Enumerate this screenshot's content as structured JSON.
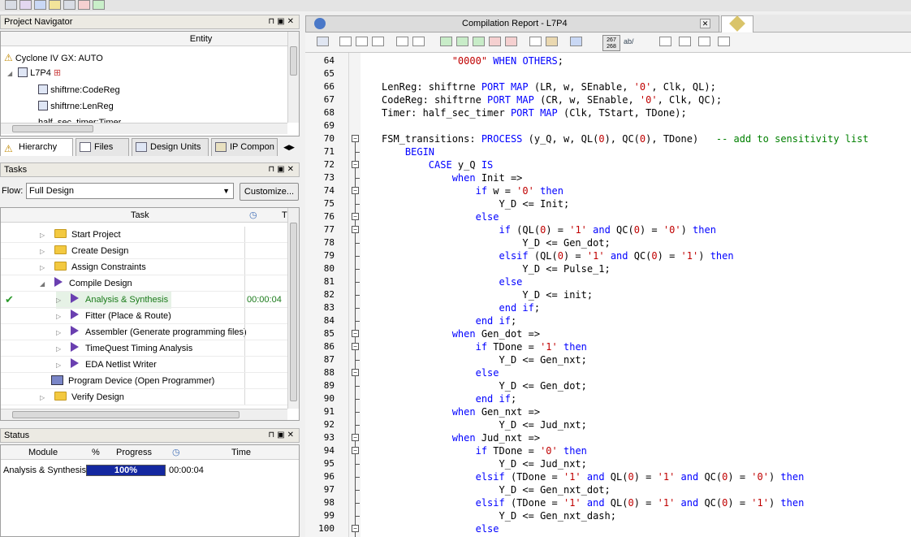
{
  "toolbar": {
    "icons": [
      "stop-icon",
      "start-analysis-icon",
      "timequest-icon",
      "netlist-icon",
      "chip-planner-icon",
      "rtl-icon",
      "check-icon"
    ]
  },
  "project_navigator": {
    "title": "Project Navigator",
    "column": "Entity",
    "items": [
      {
        "label": "Cyclone IV GX: AUTO"
      },
      {
        "label": "L7P4"
      },
      {
        "label": "shiftrne:CodeReg"
      },
      {
        "label": "shiftrne:LenReg"
      },
      {
        "label": "half_sec_timer:Timer"
      }
    ],
    "tabs": [
      "Hierarchy",
      "Files",
      "Design Units",
      "IP Compon"
    ]
  },
  "tasks": {
    "title": "Tasks",
    "flow_label": "Flow:",
    "flow_value": "Full Design",
    "customize_label": "Customize...",
    "col_task": "Task",
    "col_time": "T",
    "rows": [
      {
        "label": "Start Project",
        "time": ""
      },
      {
        "label": "Create Design",
        "time": ""
      },
      {
        "label": "Assign Constraints",
        "time": ""
      },
      {
        "label": "Compile Design",
        "time": ""
      },
      {
        "label": "Analysis & Synthesis",
        "time": "00:00:04"
      },
      {
        "label": "Fitter (Place & Route)",
        "time": ""
      },
      {
        "label": "Assembler (Generate programming files)",
        "time": ""
      },
      {
        "label": "TimeQuest Timing Analysis",
        "time": ""
      },
      {
        "label": "EDA Netlist Writer",
        "time": ""
      },
      {
        "label": "Program Device (Open Programmer)",
        "time": ""
      },
      {
        "label": "Verify Design",
        "time": ""
      }
    ]
  },
  "status": {
    "title": "Status",
    "col_module": "Module",
    "col_pct": "%",
    "col_progress": "Progress",
    "col_time": "Time",
    "row": {
      "module": "Analysis & Synthesis",
      "progress_label": "100%",
      "progress": 1.0,
      "time": "00:00:04"
    }
  },
  "editor": {
    "tab_title": "Compilation Report - L7P4",
    "toolbar_text": "267\n268",
    "lines": [
      {
        "n": "64",
        "t": [
          [
            "            ",
            ""
          ],
          [
            "\"0000\"",
            "st"
          ],
          [
            " ",
            ""
          ],
          [
            "WHEN",
            "kw"
          ],
          [
            " ",
            ""
          ],
          [
            "OTHERS",
            "kw"
          ],
          [
            ";",
            ""
          ]
        ]
      },
      {
        "n": "65",
        "t": []
      },
      {
        "n": "66",
        "t": [
          [
            "LenReg: shiftrne ",
            ""
          ],
          [
            "PORT MAP",
            "kw"
          ],
          [
            " (LR, w, SEnable, ",
            ""
          ],
          [
            "'0'",
            "st"
          ],
          [
            ", Clk, QL);",
            ""
          ]
        ]
      },
      {
        "n": "67",
        "t": [
          [
            "CodeReg: shiftrne ",
            ""
          ],
          [
            "PORT MAP",
            "kw"
          ],
          [
            " (CR, w, SEnable, ",
            ""
          ],
          [
            "'0'",
            "st"
          ],
          [
            ", Clk, QC);",
            ""
          ]
        ]
      },
      {
        "n": "68",
        "t": [
          [
            "Timer: half_sec_timer ",
            ""
          ],
          [
            "PORT MAP",
            "kw"
          ],
          [
            " (Clk, TStart, TDone);",
            ""
          ]
        ]
      },
      {
        "n": "69",
        "t": []
      },
      {
        "n": "70",
        "t": [
          [
            "FSM_transitions: ",
            ""
          ],
          [
            "PROCESS",
            "kw"
          ],
          [
            " (y_Q, w, QL(",
            ""
          ],
          [
            "0",
            "st"
          ],
          [
            "), QC(",
            ""
          ],
          [
            "0",
            "st"
          ],
          [
            "), TDone)   ",
            ""
          ],
          [
            "-- add to sensitivity list",
            "cm"
          ]
        ]
      },
      {
        "n": "71",
        "t": [
          [
            "    ",
            ""
          ],
          [
            "BEGIN",
            "kw"
          ]
        ]
      },
      {
        "n": "72",
        "t": [
          [
            "        ",
            ""
          ],
          [
            "CASE",
            "kw"
          ],
          [
            " y_Q ",
            ""
          ],
          [
            "IS",
            "kw"
          ]
        ]
      },
      {
        "n": "73",
        "t": [
          [
            "            ",
            ""
          ],
          [
            "when",
            "kw"
          ],
          [
            " Init =>",
            ""
          ]
        ]
      },
      {
        "n": "74",
        "t": [
          [
            "                ",
            ""
          ],
          [
            "if",
            "kw"
          ],
          [
            " w = ",
            ""
          ],
          [
            "'0'",
            "st"
          ],
          [
            " ",
            ""
          ],
          [
            "then",
            "kw"
          ]
        ]
      },
      {
        "n": "75",
        "t": [
          [
            "                    Y_D <= Init;",
            ""
          ]
        ]
      },
      {
        "n": "76",
        "t": [
          [
            "                ",
            ""
          ],
          [
            "else",
            "kw"
          ]
        ]
      },
      {
        "n": "77",
        "t": [
          [
            "                    ",
            ""
          ],
          [
            "if",
            "kw"
          ],
          [
            " (QL(",
            ""
          ],
          [
            "0",
            "st"
          ],
          [
            ") = ",
            ""
          ],
          [
            "'1'",
            "st"
          ],
          [
            " ",
            ""
          ],
          [
            "and",
            "kw"
          ],
          [
            " QC(",
            ""
          ],
          [
            "0",
            "st"
          ],
          [
            ") = ",
            ""
          ],
          [
            "'0'",
            "st"
          ],
          [
            ") ",
            ""
          ],
          [
            "then",
            "kw"
          ]
        ]
      },
      {
        "n": "78",
        "t": [
          [
            "                        Y_D <= Gen_dot;",
            ""
          ]
        ]
      },
      {
        "n": "79",
        "t": [
          [
            "                    ",
            ""
          ],
          [
            "elsif",
            "kw"
          ],
          [
            " (QL(",
            ""
          ],
          [
            "0",
            "st"
          ],
          [
            ") = ",
            ""
          ],
          [
            "'1'",
            "st"
          ],
          [
            " ",
            ""
          ],
          [
            "and",
            "kw"
          ],
          [
            " QC(",
            ""
          ],
          [
            "0",
            "st"
          ],
          [
            ") = ",
            ""
          ],
          [
            "'1'",
            "st"
          ],
          [
            ") ",
            ""
          ],
          [
            "then",
            "kw"
          ]
        ]
      },
      {
        "n": "80",
        "t": [
          [
            "                        Y_D <= Pulse_1;",
            ""
          ]
        ]
      },
      {
        "n": "81",
        "t": [
          [
            "                    ",
            ""
          ],
          [
            "else",
            "kw"
          ]
        ]
      },
      {
        "n": "82",
        "t": [
          [
            "                        Y_D <= init;",
            ""
          ]
        ]
      },
      {
        "n": "83",
        "t": [
          [
            "                    ",
            ""
          ],
          [
            "end if",
            "kw"
          ],
          [
            ";",
            ""
          ]
        ]
      },
      {
        "n": "84",
        "t": [
          [
            "                ",
            ""
          ],
          [
            "end if",
            "kw"
          ],
          [
            ";",
            ""
          ]
        ]
      },
      {
        "n": "85",
        "t": [
          [
            "            ",
            ""
          ],
          [
            "when",
            "kw"
          ],
          [
            " Gen_dot =>",
            ""
          ]
        ]
      },
      {
        "n": "86",
        "t": [
          [
            "                ",
            ""
          ],
          [
            "if",
            "kw"
          ],
          [
            " TDone = ",
            ""
          ],
          [
            "'1'",
            "st"
          ],
          [
            " ",
            ""
          ],
          [
            "then",
            "kw"
          ]
        ]
      },
      {
        "n": "87",
        "t": [
          [
            "                    Y_D <= Gen_nxt;",
            ""
          ]
        ]
      },
      {
        "n": "88",
        "t": [
          [
            "                ",
            ""
          ],
          [
            "else",
            "kw"
          ]
        ]
      },
      {
        "n": "89",
        "t": [
          [
            "                    Y_D <= Gen_dot;",
            ""
          ]
        ]
      },
      {
        "n": "90",
        "t": [
          [
            "                ",
            ""
          ],
          [
            "end if",
            "kw"
          ],
          [
            ";",
            ""
          ]
        ]
      },
      {
        "n": "91",
        "t": [
          [
            "            ",
            ""
          ],
          [
            "when",
            "kw"
          ],
          [
            " Gen_nxt =>",
            ""
          ]
        ]
      },
      {
        "n": "92",
        "t": [
          [
            "                    Y_D <= Jud_nxt;",
            ""
          ]
        ]
      },
      {
        "n": "93",
        "t": [
          [
            "            ",
            ""
          ],
          [
            "when",
            "kw"
          ],
          [
            " Jud_nxt =>",
            ""
          ]
        ]
      },
      {
        "n": "94",
        "t": [
          [
            "                ",
            ""
          ],
          [
            "if",
            "kw"
          ],
          [
            " TDone = ",
            ""
          ],
          [
            "'0'",
            "st"
          ],
          [
            " ",
            ""
          ],
          [
            "then",
            "kw"
          ]
        ]
      },
      {
        "n": "95",
        "t": [
          [
            "                    Y_D <= Jud_nxt;",
            ""
          ]
        ]
      },
      {
        "n": "96",
        "t": [
          [
            "                ",
            ""
          ],
          [
            "elsif",
            "kw"
          ],
          [
            " (TDone = ",
            ""
          ],
          [
            "'1'",
            "st"
          ],
          [
            " ",
            ""
          ],
          [
            "and",
            "kw"
          ],
          [
            " QL(",
            ""
          ],
          [
            "0",
            "st"
          ],
          [
            ") = ",
            ""
          ],
          [
            "'1'",
            "st"
          ],
          [
            " ",
            ""
          ],
          [
            "and",
            "kw"
          ],
          [
            " QC(",
            ""
          ],
          [
            "0",
            "st"
          ],
          [
            ") = ",
            ""
          ],
          [
            "'0'",
            "st"
          ],
          [
            ") ",
            ""
          ],
          [
            "then",
            "kw"
          ]
        ]
      },
      {
        "n": "97",
        "t": [
          [
            "                    Y_D <= Gen_nxt_dot;",
            ""
          ]
        ]
      },
      {
        "n": "98",
        "t": [
          [
            "                ",
            ""
          ],
          [
            "elsif",
            "kw"
          ],
          [
            " (TDone = ",
            ""
          ],
          [
            "'1'",
            "st"
          ],
          [
            " ",
            ""
          ],
          [
            "and",
            "kw"
          ],
          [
            " QL(",
            ""
          ],
          [
            "0",
            "st"
          ],
          [
            ") = ",
            ""
          ],
          [
            "'1'",
            "st"
          ],
          [
            " ",
            ""
          ],
          [
            "and",
            "kw"
          ],
          [
            " QC(",
            ""
          ],
          [
            "0",
            "st"
          ],
          [
            ") = ",
            ""
          ],
          [
            "'1'",
            "st"
          ],
          [
            ") ",
            ""
          ],
          [
            "then",
            "kw"
          ]
        ]
      },
      {
        "n": "99",
        "t": [
          [
            "                    Y_D <= Gen_nxt_dash;",
            ""
          ]
        ]
      },
      {
        "n": "100",
        "t": [
          [
            "                ",
            ""
          ],
          [
            "else",
            "kw"
          ]
        ]
      }
    ]
  }
}
